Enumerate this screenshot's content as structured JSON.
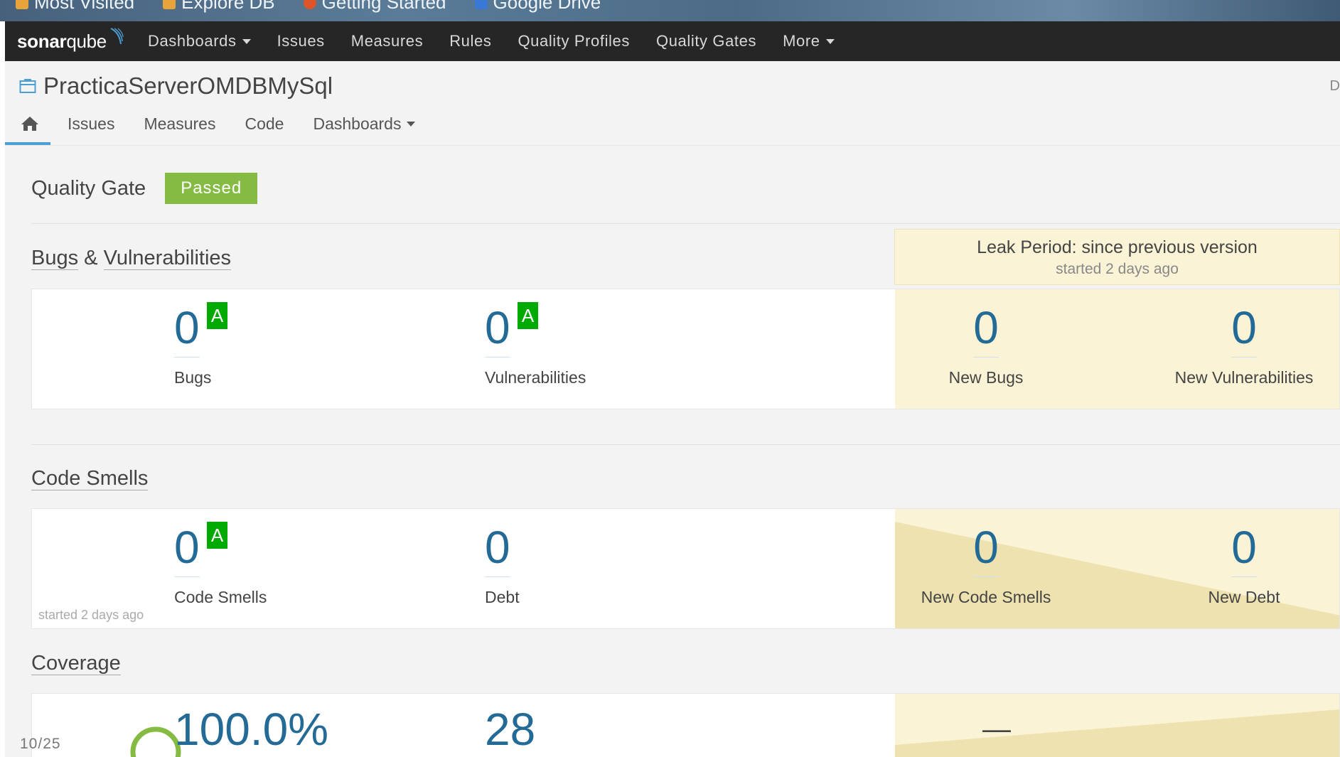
{
  "browser": {
    "bookmarks": [
      {
        "icon": "bookmark-folder-icon",
        "label": "Most Visited"
      },
      {
        "icon": "bookmark-page-icon",
        "label": "Explore DB"
      },
      {
        "icon": "firefox-icon",
        "label": "Getting Started"
      },
      {
        "icon": "google-drive-icon",
        "label": "Google Drive"
      }
    ]
  },
  "topnav": {
    "logo_bold": "sonar",
    "logo_light": "qube",
    "items": [
      {
        "label": "Dashboards",
        "dropdown": true
      },
      {
        "label": "Issues"
      },
      {
        "label": "Measures"
      },
      {
        "label": "Rules"
      },
      {
        "label": "Quality Profiles"
      },
      {
        "label": "Quality Gates"
      },
      {
        "label": "More",
        "dropdown": true
      }
    ]
  },
  "component": {
    "icon": "project-icon",
    "name": "PracticaServerOMDBMySql",
    "edge_text": "D",
    "tabs": {
      "home_icon": "home-icon",
      "issues": "Issues",
      "measures": "Measures",
      "code": "Code",
      "dashboards": "Dashboards"
    }
  },
  "quality_gate": {
    "label": "Quality Gate",
    "status": "Passed",
    "status_color": "#85bb43"
  },
  "leak_period": {
    "title": "Leak Period: since previous version",
    "subtitle": "started 2 days ago",
    "bg_color": "#fbf3d5"
  },
  "bugs_vulnerabilities": {
    "title_part1": "Bugs",
    "title_amp": " & ",
    "title_part2": "Vulnerabilities",
    "bugs": {
      "value": "0",
      "rating": "A",
      "label": "Bugs"
    },
    "vulnerabilities": {
      "value": "0",
      "rating": "A",
      "label": "Vulnerabilities"
    },
    "new_bugs": {
      "value": "0",
      "label": "New Bugs"
    },
    "new_vulnerabilities": {
      "value": "0",
      "label": "New Vulnerabilities"
    }
  },
  "code_smells": {
    "title": "Code Smells",
    "code_smells": {
      "value": "0",
      "rating": "A",
      "label": "Code Smells"
    },
    "debt": {
      "value": "0",
      "label": "Debt"
    },
    "new_code_smells": {
      "value": "0",
      "label": "New Code Smells"
    },
    "new_debt": {
      "value": "0",
      "label": "New Debt"
    },
    "note": "started 2 days ago"
  },
  "coverage": {
    "title": "Coverage",
    "coverage_value": "100.0%",
    "coverage_fraction": 1.0,
    "second_value": "28",
    "leak_value": "—"
  },
  "colors": {
    "metric_blue": "#236a97",
    "rating_a": "#00aa00",
    "topnav_bg": "#262626"
  },
  "page_number": "10/25"
}
